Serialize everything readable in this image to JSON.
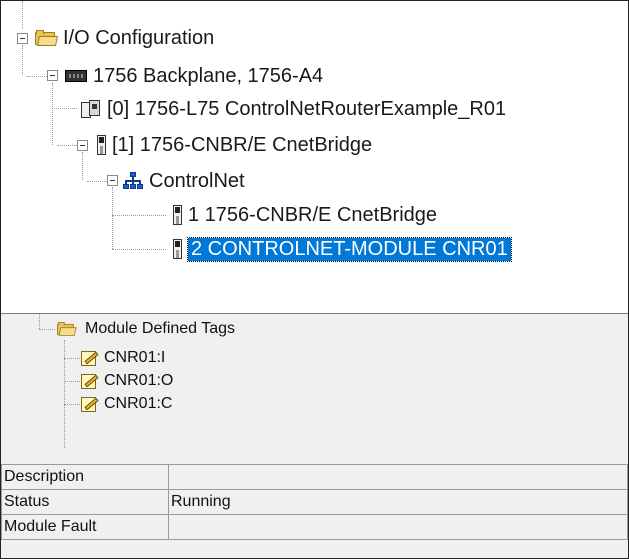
{
  "tree": {
    "root": {
      "label": "I/O Configuration",
      "icon": "folder-icon"
    },
    "backplane": {
      "label": "1756 Backplane, 1756-A4",
      "icon": "backplane-icon"
    },
    "controller": {
      "label": "[0] 1756-L75 ControlNetRouterExample_R01",
      "icon": "controller-icon"
    },
    "bridge": {
      "label": "[1] 1756-CNBR/E CnetBridge",
      "icon": "module-icon"
    },
    "network": {
      "label": "ControlNet",
      "icon": "network-icon"
    },
    "net_nodes": [
      {
        "label": "1 1756-CNBR/E CnetBridge",
        "icon": "module-icon"
      },
      {
        "label": "2 CONTROLNET-MODULE CNR01",
        "icon": "module-icon",
        "selected": true
      }
    ]
  },
  "tags": {
    "folder": {
      "label": "Module Defined Tags",
      "icon": "folder-icon"
    },
    "items": [
      {
        "label": "CNR01:I",
        "icon": "tag-icon"
      },
      {
        "label": "CNR01:O",
        "icon": "tag-icon"
      },
      {
        "label": "CNR01:C",
        "icon": "tag-icon"
      }
    ]
  },
  "properties": [
    {
      "key": "Description",
      "value": ""
    },
    {
      "key": "Status",
      "value": "Running"
    },
    {
      "key": "Module Fault",
      "value": ""
    }
  ],
  "colors": {
    "selection": "#0078d7",
    "folder": "#e8c35a",
    "panel": "#f0f0f0"
  }
}
